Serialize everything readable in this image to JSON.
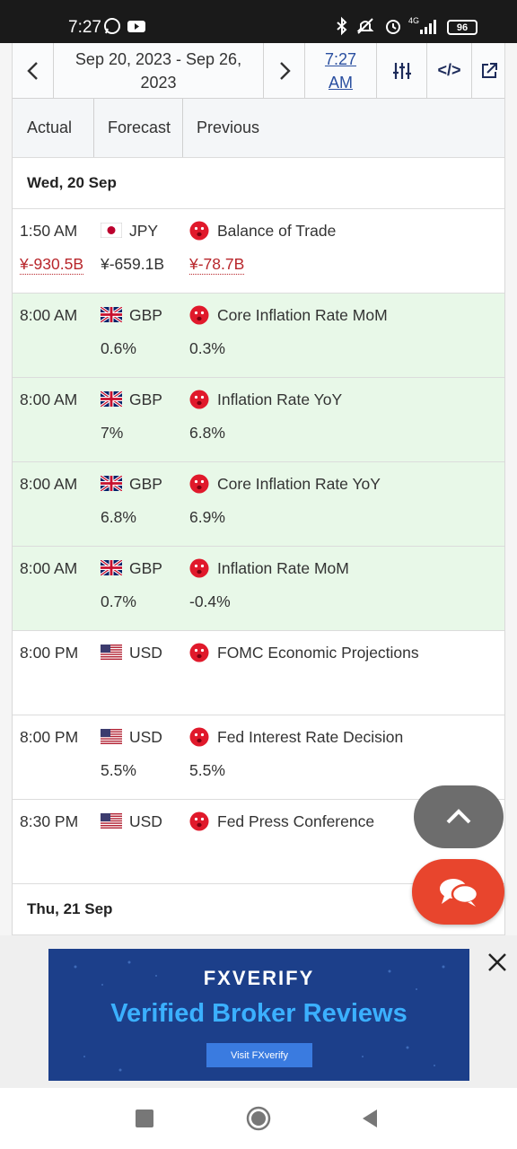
{
  "status_bar": {
    "time": "7:27",
    "battery": "96",
    "network": "4G",
    "icons": [
      "whatsapp-icon",
      "youtube-icon",
      "bluetooth-icon",
      "mute-icon",
      "alarm-icon",
      "signal-icon",
      "battery-icon"
    ]
  },
  "toolbar": {
    "range_line1": "Sep 20, 2023 - Sep 26,",
    "range_line2": "2023",
    "time_line1": "7:27",
    "time_line2": "AM",
    "code_label": "</>"
  },
  "columns": {
    "actual": "Actual",
    "forecast": "Forecast",
    "previous": "Previous"
  },
  "days": [
    {
      "label": "Wed, 20 Sep"
    },
    {
      "label": "Thu, 21 Sep"
    }
  ],
  "events": [
    {
      "time": "1:50 AM",
      "country": "JPY",
      "flag": "japan-flag-icon",
      "name": "Balance of Trade",
      "actual": "¥-930.5B",
      "forecast": "¥-659.1B",
      "previous": "¥-78.7B",
      "highlight": false
    },
    {
      "time": "8:00 AM",
      "country": "GBP",
      "flag": "uk-flag-icon",
      "name": "Core Inflation Rate MoM",
      "actual": "",
      "forecast": "0.6%",
      "previous": "0.3%",
      "highlight": true
    },
    {
      "time": "8:00 AM",
      "country": "GBP",
      "flag": "uk-flag-icon",
      "name": "Inflation Rate YoY",
      "actual": "",
      "forecast": "7%",
      "previous": "6.8%",
      "highlight": true
    },
    {
      "time": "8:00 AM",
      "country": "GBP",
      "flag": "uk-flag-icon",
      "name": "Core Inflation Rate YoY",
      "actual": "",
      "forecast": "6.8%",
      "previous": "6.9%",
      "highlight": true
    },
    {
      "time": "8:00 AM",
      "country": "GBP",
      "flag": "uk-flag-icon",
      "name": "Inflation Rate MoM",
      "actual": "",
      "forecast": "0.7%",
      "previous": "-0.4%",
      "highlight": true
    },
    {
      "time": "8:00 PM",
      "country": "USD",
      "flag": "us-flag-icon",
      "name": "FOMC Economic Projections",
      "actual": "",
      "forecast": "",
      "previous": "",
      "highlight": false
    },
    {
      "time": "8:00 PM",
      "country": "USD",
      "flag": "us-flag-icon",
      "name": "Fed Interest Rate Decision",
      "actual": "",
      "forecast": "5.5%",
      "previous": "5.5%",
      "highlight": false
    },
    {
      "time": "8:30 PM",
      "country": "USD",
      "flag": "us-flag-icon",
      "name": "Fed Press Conference",
      "actual": "",
      "forecast": "",
      "previous": "",
      "highlight": false
    }
  ],
  "ad": {
    "brand": "FXVERIFY",
    "headline": "Verified Broker Reviews",
    "cta": "Visit FXverify"
  },
  "colors": {
    "highlight_row": "#e8f8e8",
    "negative_value": "#b8262b",
    "importance_dot": "#e0192b",
    "chat_button": "#e8452d",
    "scroll_top_button": "#6d6d6d",
    "ad_background": "#1c3f8a",
    "ad_headline": "#3bb0ff",
    "link": "#2a4fa0"
  }
}
